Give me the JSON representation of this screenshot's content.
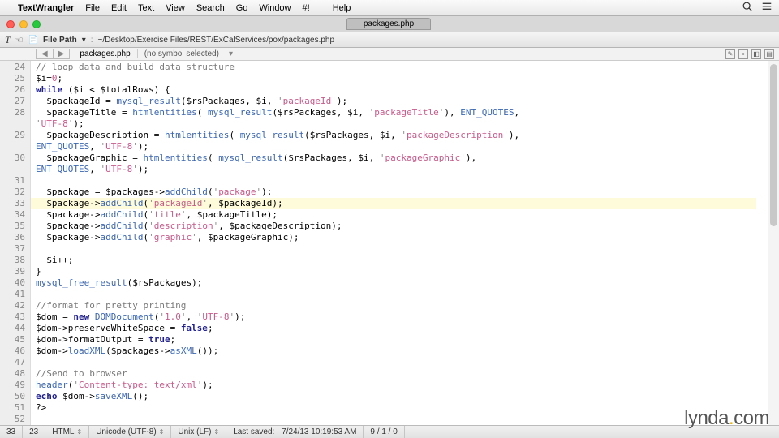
{
  "menubar": {
    "apple": "",
    "app": "TextWrangler",
    "items": [
      "File",
      "Edit",
      "Text",
      "View",
      "Search",
      "Go",
      "Window",
      "#!",
      "",
      "Help"
    ]
  },
  "tab": {
    "title": "packages.php"
  },
  "pathbar": {
    "label": "File Path",
    "path": "~/Desktop/Exercise Files/REST/ExCalServices/pox/packages.php"
  },
  "symbar": {
    "file": "packages.php",
    "symbol": "(no symbol selected)"
  },
  "gutter": {
    "start": 24,
    "end": 52
  },
  "highlight_row": 33,
  "code_lines": [
    {
      "n": 24,
      "html": "<span class='c-comment'>// loop data and build data structure</span>"
    },
    {
      "n": 25,
      "html": "$i=<span class='c-pk'>0</span>;"
    },
    {
      "n": 26,
      "html": "<span class='c-kw'>while</span> ($i &lt; $totalRows) {"
    },
    {
      "n": 27,
      "html": "  $packageId = <span class='c-func'>mysql_result</span>($rsPackages, $i, <span class='c-sq'>'</span><span class='c-pk'>packageId</span><span class='c-sq'>'</span>);"
    },
    {
      "n": 28,
      "html": "  $packageTitle = <span class='c-func'>htmlentities</span>( <span class='c-func'>mysql_result</span>($rsPackages, $i, <span class='c-sq'>'</span><span class='c-pk'>packageTitle</span><span class='c-sq'>'</span>), <span class='c-func'>ENT_QUOTES</span>,\n<span class='c-sq'>'</span><span class='c-pk'>UTF-8</span><span class='c-sq'>'</span>);"
    },
    {
      "n": 29,
      "html": "  $packageDescription = <span class='c-func'>htmlentities</span>( <span class='c-func'>mysql_result</span>($rsPackages, $i, <span class='c-sq'>'</span><span class='c-pk'>packageDescription</span><span class='c-sq'>'</span>),\n<span class='c-func'>ENT_QUOTES</span>, <span class='c-sq'>'</span><span class='c-pk'>UTF-8</span><span class='c-sq'>'</span>);"
    },
    {
      "n": 30,
      "html": "  $packageGraphic = <span class='c-func'>htmlentities</span>( <span class='c-func'>mysql_result</span>($rsPackages, $i, <span class='c-sq'>'</span><span class='c-pk'>packageGraphic</span><span class='c-sq'>'</span>),\n<span class='c-func'>ENT_QUOTES</span>, <span class='c-sq'>'</span><span class='c-pk'>UTF-8</span><span class='c-sq'>'</span>);"
    },
    {
      "n": 31,
      "html": ""
    },
    {
      "n": 32,
      "html": "  $package = $packages-&gt;<span class='c-func'>addChild</span>(<span class='c-sq'>'</span><span class='c-pk'>package</span><span class='c-sq'>'</span>);"
    },
    {
      "n": 33,
      "html": "  $package-&gt;<span class='c-func'>addChild</span>(<span class='c-sq'>'</span><span class='c-pk'>packageId</span><span class='c-sq'>'</span>, $packageId);"
    },
    {
      "n": 34,
      "html": "  $package-&gt;<span class='c-func'>addChild</span>(<span class='c-sq'>'</span><span class='c-pk'>title</span><span class='c-sq'>'</span>, $packageTitle);"
    },
    {
      "n": 35,
      "html": "  $package-&gt;<span class='c-func'>addChild</span>(<span class='c-sq'>'</span><span class='c-pk'>description</span><span class='c-sq'>'</span>, $packageDescription);"
    },
    {
      "n": 36,
      "html": "  $package-&gt;<span class='c-func'>addChild</span>(<span class='c-sq'>'</span><span class='c-pk'>graphic</span><span class='c-sq'>'</span>, $packageGraphic);"
    },
    {
      "n": 37,
      "html": ""
    },
    {
      "n": 38,
      "html": "  $i++;"
    },
    {
      "n": 39,
      "html": "}"
    },
    {
      "n": 40,
      "html": "<span class='c-func'>mysql_free_result</span>($rsPackages);"
    },
    {
      "n": 41,
      "html": ""
    },
    {
      "n": 42,
      "html": "<span class='c-comment'>//format for pretty printing</span>"
    },
    {
      "n": 43,
      "html": "$dom = <span class='c-kw'>new</span> <span class='c-func'>DOMDocument</span>(<span class='c-sq'>'</span><span class='c-pk'>1.0</span><span class='c-sq'>'</span>, <span class='c-sq'>'</span><span class='c-pk'>UTF-8</span><span class='c-sq'>'</span>);"
    },
    {
      "n": 44,
      "html": "$dom-&gt;preserveWhiteSpace = <span class='c-kw'>false</span>;"
    },
    {
      "n": 45,
      "html": "$dom-&gt;formatOutput = <span class='c-kw'>true</span>;"
    },
    {
      "n": 46,
      "html": "$dom-&gt;<span class='c-func'>loadXML</span>($packages-&gt;<span class='c-func'>asXML</span>());"
    },
    {
      "n": 47,
      "html": ""
    },
    {
      "n": 48,
      "html": "<span class='c-comment'>//Send to browser</span>"
    },
    {
      "n": 49,
      "html": "<span class='c-func'>header</span>(<span class='c-sq'>'</span><span class='c-pk'>Content-type: text/xml</span><span class='c-sq'>'</span>);"
    },
    {
      "n": 50,
      "html": "<span class='c-kw'>echo</span> $dom-&gt;<span class='c-func'>saveXML</span>();"
    },
    {
      "n": 51,
      "html": "?&gt;"
    },
    {
      "n": 52,
      "html": ""
    }
  ],
  "statusbar": {
    "line": "33",
    "col": "23",
    "lang": "HTML",
    "enc": "Unicode (UTF-8)",
    "le": "Unix (LF)",
    "saved_label": "Last saved:",
    "saved": "7/24/13 10:19:53 AM",
    "counts": "9 / 1 / 0"
  },
  "watermark": {
    "brand": "lynda",
    "dot": ".",
    "suffix": "com"
  }
}
